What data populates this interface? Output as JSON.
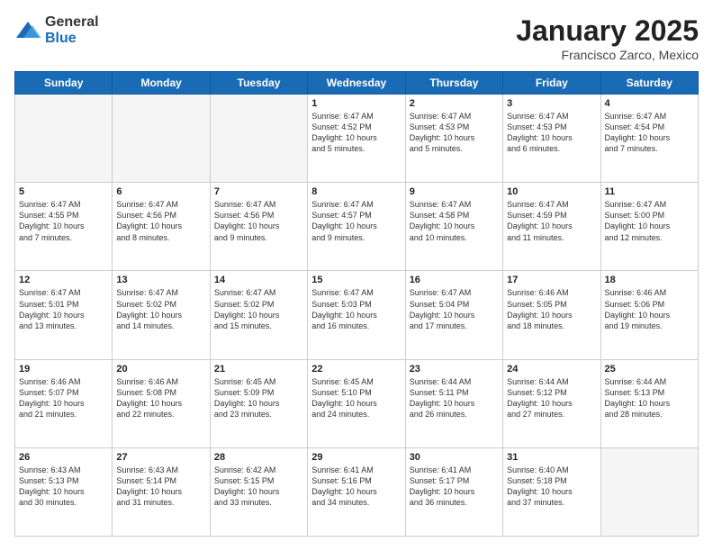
{
  "header": {
    "logo_general": "General",
    "logo_blue": "Blue",
    "month_title": "January 2025",
    "location": "Francisco Zarco, Mexico"
  },
  "weekdays": [
    "Sunday",
    "Monday",
    "Tuesday",
    "Wednesday",
    "Thursday",
    "Friday",
    "Saturday"
  ],
  "weeks": [
    [
      {
        "day": "",
        "empty": true,
        "lines": []
      },
      {
        "day": "",
        "empty": true,
        "lines": []
      },
      {
        "day": "",
        "empty": true,
        "lines": []
      },
      {
        "day": "1",
        "empty": false,
        "lines": [
          "Sunrise: 6:47 AM",
          "Sunset: 4:52 PM",
          "Daylight: 10 hours",
          "and 5 minutes."
        ]
      },
      {
        "day": "2",
        "empty": false,
        "lines": [
          "Sunrise: 6:47 AM",
          "Sunset: 4:53 PM",
          "Daylight: 10 hours",
          "and 5 minutes."
        ]
      },
      {
        "day": "3",
        "empty": false,
        "lines": [
          "Sunrise: 6:47 AM",
          "Sunset: 4:53 PM",
          "Daylight: 10 hours",
          "and 6 minutes."
        ]
      },
      {
        "day": "4",
        "empty": false,
        "lines": [
          "Sunrise: 6:47 AM",
          "Sunset: 4:54 PM",
          "Daylight: 10 hours",
          "and 7 minutes."
        ]
      }
    ],
    [
      {
        "day": "5",
        "empty": false,
        "lines": [
          "Sunrise: 6:47 AM",
          "Sunset: 4:55 PM",
          "Daylight: 10 hours",
          "and 7 minutes."
        ]
      },
      {
        "day": "6",
        "empty": false,
        "lines": [
          "Sunrise: 6:47 AM",
          "Sunset: 4:56 PM",
          "Daylight: 10 hours",
          "and 8 minutes."
        ]
      },
      {
        "day": "7",
        "empty": false,
        "lines": [
          "Sunrise: 6:47 AM",
          "Sunset: 4:56 PM",
          "Daylight: 10 hours",
          "and 9 minutes."
        ]
      },
      {
        "day": "8",
        "empty": false,
        "lines": [
          "Sunrise: 6:47 AM",
          "Sunset: 4:57 PM",
          "Daylight: 10 hours",
          "and 9 minutes."
        ]
      },
      {
        "day": "9",
        "empty": false,
        "lines": [
          "Sunrise: 6:47 AM",
          "Sunset: 4:58 PM",
          "Daylight: 10 hours",
          "and 10 minutes."
        ]
      },
      {
        "day": "10",
        "empty": false,
        "lines": [
          "Sunrise: 6:47 AM",
          "Sunset: 4:59 PM",
          "Daylight: 10 hours",
          "and 11 minutes."
        ]
      },
      {
        "day": "11",
        "empty": false,
        "lines": [
          "Sunrise: 6:47 AM",
          "Sunset: 5:00 PM",
          "Daylight: 10 hours",
          "and 12 minutes."
        ]
      }
    ],
    [
      {
        "day": "12",
        "empty": false,
        "lines": [
          "Sunrise: 6:47 AM",
          "Sunset: 5:01 PM",
          "Daylight: 10 hours",
          "and 13 minutes."
        ]
      },
      {
        "day": "13",
        "empty": false,
        "lines": [
          "Sunrise: 6:47 AM",
          "Sunset: 5:02 PM",
          "Daylight: 10 hours",
          "and 14 minutes."
        ]
      },
      {
        "day": "14",
        "empty": false,
        "lines": [
          "Sunrise: 6:47 AM",
          "Sunset: 5:02 PM",
          "Daylight: 10 hours",
          "and 15 minutes."
        ]
      },
      {
        "day": "15",
        "empty": false,
        "lines": [
          "Sunrise: 6:47 AM",
          "Sunset: 5:03 PM",
          "Daylight: 10 hours",
          "and 16 minutes."
        ]
      },
      {
        "day": "16",
        "empty": false,
        "lines": [
          "Sunrise: 6:47 AM",
          "Sunset: 5:04 PM",
          "Daylight: 10 hours",
          "and 17 minutes."
        ]
      },
      {
        "day": "17",
        "empty": false,
        "lines": [
          "Sunrise: 6:46 AM",
          "Sunset: 5:05 PM",
          "Daylight: 10 hours",
          "and 18 minutes."
        ]
      },
      {
        "day": "18",
        "empty": false,
        "lines": [
          "Sunrise: 6:46 AM",
          "Sunset: 5:06 PM",
          "Daylight: 10 hours",
          "and 19 minutes."
        ]
      }
    ],
    [
      {
        "day": "19",
        "empty": false,
        "lines": [
          "Sunrise: 6:46 AM",
          "Sunset: 5:07 PM",
          "Daylight: 10 hours",
          "and 21 minutes."
        ]
      },
      {
        "day": "20",
        "empty": false,
        "lines": [
          "Sunrise: 6:46 AM",
          "Sunset: 5:08 PM",
          "Daylight: 10 hours",
          "and 22 minutes."
        ]
      },
      {
        "day": "21",
        "empty": false,
        "lines": [
          "Sunrise: 6:45 AM",
          "Sunset: 5:09 PM",
          "Daylight: 10 hours",
          "and 23 minutes."
        ]
      },
      {
        "day": "22",
        "empty": false,
        "lines": [
          "Sunrise: 6:45 AM",
          "Sunset: 5:10 PM",
          "Daylight: 10 hours",
          "and 24 minutes."
        ]
      },
      {
        "day": "23",
        "empty": false,
        "lines": [
          "Sunrise: 6:44 AM",
          "Sunset: 5:11 PM",
          "Daylight: 10 hours",
          "and 26 minutes."
        ]
      },
      {
        "day": "24",
        "empty": false,
        "lines": [
          "Sunrise: 6:44 AM",
          "Sunset: 5:12 PM",
          "Daylight: 10 hours",
          "and 27 minutes."
        ]
      },
      {
        "day": "25",
        "empty": false,
        "lines": [
          "Sunrise: 6:44 AM",
          "Sunset: 5:13 PM",
          "Daylight: 10 hours",
          "and 28 minutes."
        ]
      }
    ],
    [
      {
        "day": "26",
        "empty": false,
        "lines": [
          "Sunrise: 6:43 AM",
          "Sunset: 5:13 PM",
          "Daylight: 10 hours",
          "and 30 minutes."
        ]
      },
      {
        "day": "27",
        "empty": false,
        "lines": [
          "Sunrise: 6:43 AM",
          "Sunset: 5:14 PM",
          "Daylight: 10 hours",
          "and 31 minutes."
        ]
      },
      {
        "day": "28",
        "empty": false,
        "lines": [
          "Sunrise: 6:42 AM",
          "Sunset: 5:15 PM",
          "Daylight: 10 hours",
          "and 33 minutes."
        ]
      },
      {
        "day": "29",
        "empty": false,
        "lines": [
          "Sunrise: 6:41 AM",
          "Sunset: 5:16 PM",
          "Daylight: 10 hours",
          "and 34 minutes."
        ]
      },
      {
        "day": "30",
        "empty": false,
        "lines": [
          "Sunrise: 6:41 AM",
          "Sunset: 5:17 PM",
          "Daylight: 10 hours",
          "and 36 minutes."
        ]
      },
      {
        "day": "31",
        "empty": false,
        "lines": [
          "Sunrise: 6:40 AM",
          "Sunset: 5:18 PM",
          "Daylight: 10 hours",
          "and 37 minutes."
        ]
      },
      {
        "day": "",
        "empty": true,
        "lines": []
      }
    ]
  ]
}
